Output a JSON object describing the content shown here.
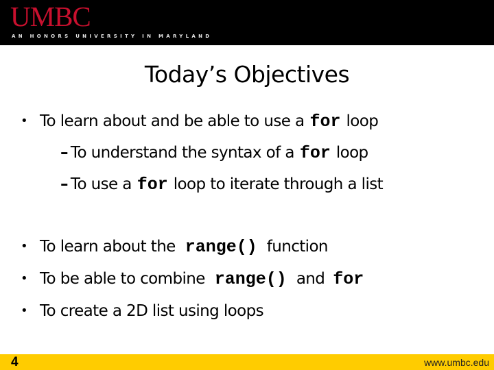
{
  "header": {
    "logo": "UMBC",
    "tagline": "AN HONORS UNIVERSITY IN MARYLAND",
    "logo_color": "#c8102e",
    "background": "#000000"
  },
  "slide": {
    "title": "Today’s Objectives",
    "bullets": [
      {
        "level": 1,
        "pre": "To learn about and be able to use a",
        "code": "for",
        "post": "loop"
      },
      {
        "level": 2,
        "pre": "To understand the syntax of a",
        "code": "for",
        "post": "loop"
      },
      {
        "level": 2,
        "pre": "To use a",
        "code": "for",
        "post": "loop to iterate through a list"
      },
      {
        "level": 1,
        "pre": "To learn about the",
        "code": "range()",
        "post": "function"
      },
      {
        "level": 1,
        "pre": "To be able to combine",
        "code": "range()",
        "post": "and",
        "code2": "for"
      },
      {
        "level": 1,
        "pre": "To create a 2D list using loops"
      }
    ]
  },
  "footer": {
    "slide_number": "4",
    "url": "www.umbc.edu",
    "background": "#ffcc00"
  }
}
